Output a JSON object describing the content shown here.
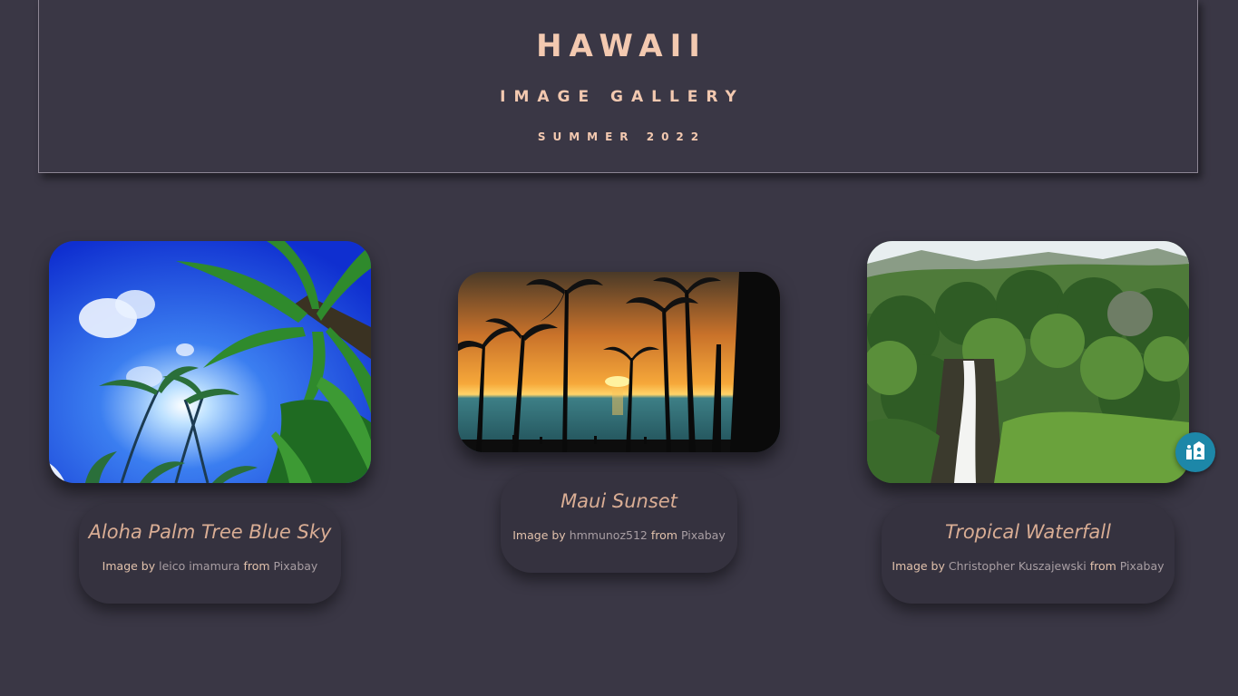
{
  "header": {
    "title": "HAWAII",
    "subtitle": "IMAGE GALLERY",
    "season": "SUMMER 2022"
  },
  "gallery": [
    {
      "image_icon": "palm-trees-blue-sky-photo",
      "title": "Aloha Palm Tree Blue Sky",
      "credit_prefix": "Image by",
      "author": "leico imamura",
      "credit_middle": "from",
      "source": "Pixabay"
    },
    {
      "image_icon": "sunset-palm-silhouettes-photo",
      "title": "Maui Sunset",
      "credit_prefix": "Image by",
      "author": "hmmunoz512",
      "credit_middle": "from",
      "source": "Pixabay"
    },
    {
      "image_icon": "waterfall-jungle-photo",
      "title": "Tropical Waterfall",
      "credit_prefix": "Image by",
      "author": "Christopher Kuszajewski",
      "credit_middle": "from",
      "source": "Pixabay"
    }
  ],
  "accessibility_button": {
    "icon": "accessibility-icon"
  },
  "colors": {
    "background": "#3a3745",
    "heading": "#f3c9b0",
    "caption_title": "#d9ad94",
    "link": "#a89ea3",
    "accessibility": "#1d87a8"
  }
}
